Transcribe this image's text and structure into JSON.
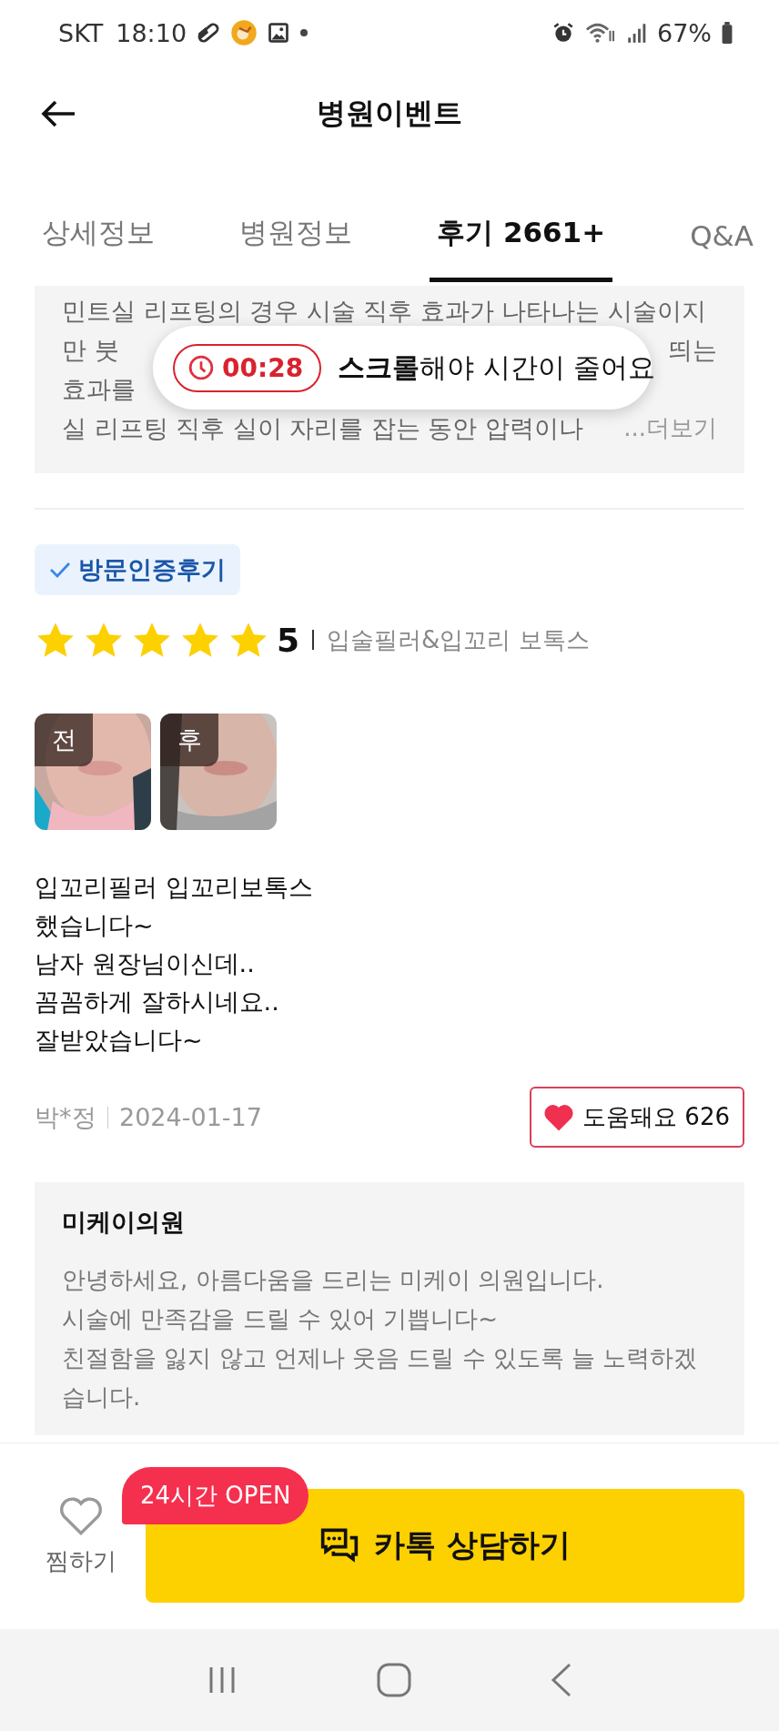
{
  "status_bar": {
    "carrier": "SKT",
    "time": "18:10",
    "battery": "67%"
  },
  "header": {
    "title": "병원이벤트"
  },
  "tabs": [
    {
      "label": "상세정보",
      "selected": false
    },
    {
      "label": "병원정보",
      "selected": false
    },
    {
      "label": "후기 2661+",
      "selected": true
    },
    {
      "label": "Q&A",
      "selected": false
    }
  ],
  "snippet": {
    "lines": [
      {
        "text": "민트실 리프팅의 경우 시술 직후 효과가 나타나는 시술이지"
      },
      {
        "text": "만 붓",
        "tail": "띄는"
      },
      {
        "text": "효과를"
      },
      {
        "text": "실 리프팅 직후 실이 자리를 잡는 동안 압력이나"
      }
    ],
    "more": "...더보기"
  },
  "toast": {
    "timer": "00:28",
    "message": "**스크롤**해야 시간이 줄어요"
  },
  "review": {
    "badge": "방문인증후기",
    "stars": 5,
    "score": "5",
    "treatment": "입술필러&입꼬리 보톡스",
    "photos": [
      {
        "label": "전"
      },
      {
        "label": "후"
      }
    ],
    "body": "입꼬리필러 입꼬리보톡스\n했습니다~\n남자 원장님이신데..\n꼼꼼하게 잘하시네요..\n잘받았습니다~",
    "author": "박*정",
    "date": "2024-01-17",
    "helpful": {
      "label": "도움돼요",
      "count": "626",
      "liked": true
    }
  },
  "reply": {
    "name": "미케이의원",
    "body": "안녕하세요, 아름다움을 드리는 미케이 의원입니다.\n시술에 만족감을 드릴 수 있어 기쁩니다~\n친절함을 잃지 않고 언제나 웃음 드릴 수 있도록 늘 노력하겠\n습니다."
  },
  "bottom_bar": {
    "wish_label": "찜하기",
    "badge": "24시간 OPEN",
    "consult_button": "카톡 상담하기"
  }
}
